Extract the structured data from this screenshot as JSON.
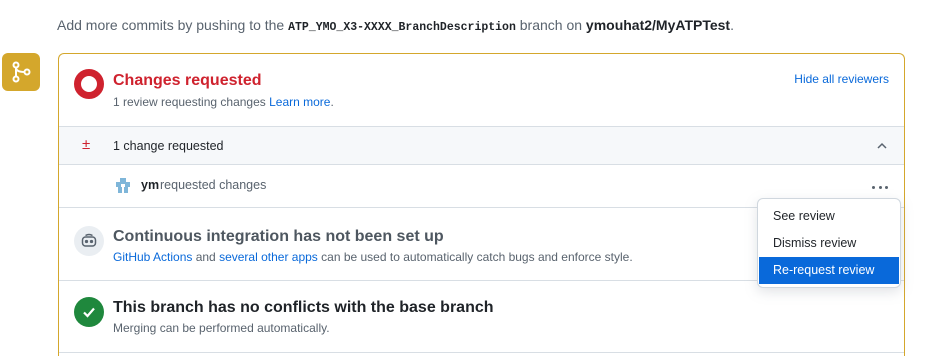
{
  "top_line": {
    "prefix": "Add more commits by pushing to the ",
    "branch": "ATP_YMO_X3-XXXX_BranchDescription",
    "middle": " branch on ",
    "repo": "ymouhat2/MyATPTest",
    "suffix": "."
  },
  "review_status": {
    "title": "Changes requested",
    "subtitle": "1 review requesting changes ",
    "learn_more": "Learn more",
    "subtitle_end": ".",
    "hide_link": "Hide all reviewers"
  },
  "change_summary": {
    "icon_glyph": "±",
    "label": "1 change requested"
  },
  "reviewer": {
    "name": "ym",
    "action": "requested changes"
  },
  "ci": {
    "title": "Continuous integration has not been set up",
    "actions_link": "GitHub Actions",
    "and": " and ",
    "other_apps_link": "several other apps",
    "rest": " can be used to automatically catch bugs and enforce style."
  },
  "conflicts": {
    "title": "This branch has no conflicts with the base branch",
    "subtitle": "Merging can be performed automatically."
  },
  "menu": {
    "items": [
      "See review",
      "Dismiss review",
      "Re-request review"
    ]
  },
  "colors": {
    "danger": "#cf222e",
    "success": "#1f883d",
    "accent": "#0969da",
    "attention": "#d4a72c"
  }
}
